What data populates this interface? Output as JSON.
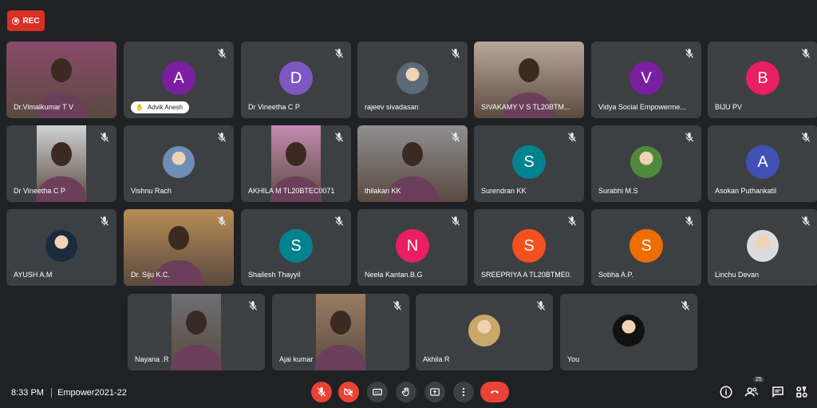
{
  "recording": {
    "label": "REC"
  },
  "participants": [
    {
      "name": "Dr.Vimalkumar T V",
      "type": "video",
      "color": "#8a4a6b"
    },
    {
      "name": "Advik Anesh",
      "type": "avatar",
      "initial": "A",
      "color": "#7b1fa2",
      "muted": true,
      "pill": true
    },
    {
      "name": "Dr Vineetha C P",
      "type": "avatar",
      "initial": "D",
      "color": "#7e57c2",
      "muted": true
    },
    {
      "name": "rajeev sivadasan",
      "type": "photo",
      "color": "#5b6a78",
      "muted": true
    },
    {
      "name": "SIVAKAMY V S TL20BTM...",
      "type": "video",
      "color": "#b9a89a"
    },
    {
      "name": "Vidya Social Empowerme...",
      "type": "avatar",
      "initial": "V",
      "color": "#7b1fa2",
      "muted": true
    },
    {
      "name": "BIJU PV",
      "type": "avatar",
      "initial": "B",
      "color": "#e91e63",
      "muted": true
    },
    {
      "name": "Dr Vineetha C P",
      "type": "video",
      "color": "#cfd2d4",
      "muted": true
    },
    {
      "name": "Vishnu Rach",
      "type": "photo",
      "color": "#6e8fb5",
      "muted": true
    },
    {
      "name": "AKHILA M TL20BTEC0071",
      "type": "video",
      "color": "#c58bb3",
      "muted": true
    },
    {
      "name": "thilakan KK",
      "type": "video",
      "color": "#8f8f8f",
      "muted": true
    },
    {
      "name": "Surendran KK",
      "type": "avatar",
      "initial": "S",
      "color": "#00838f",
      "muted": true
    },
    {
      "name": "Surabhi M.S",
      "type": "photo",
      "color": "#4f8a3a",
      "muted": true
    },
    {
      "name": "Asokan Puthankatil",
      "type": "avatar",
      "initial": "A",
      "color": "#3f51b5",
      "muted": true
    },
    {
      "name": "AYUSH A.M",
      "type": "photo",
      "color": "#1a2b3c",
      "muted": true
    },
    {
      "name": "Dr. Siju K.C.",
      "type": "video",
      "color": "#b88d55",
      "muted": true
    },
    {
      "name": "Shailesh Thayyil",
      "type": "avatar",
      "initial": "S",
      "color": "#00838f",
      "muted": true
    },
    {
      "name": "Neela Kantan.B.G",
      "type": "avatar",
      "initial": "N",
      "color": "#e91e63",
      "muted": true
    },
    {
      "name": "SREEPRIYA A TL20BTME0...",
      "type": "avatar",
      "initial": "S",
      "color": "#f4511e",
      "muted": true
    },
    {
      "name": "Sobha A.P.",
      "type": "avatar",
      "initial": "S",
      "color": "#ef6c00",
      "muted": true
    },
    {
      "name": "Linchu Devan",
      "type": "photo",
      "color": "#dcdcdc",
      "muted": true
    },
    {
      "name": "Nayana .R",
      "type": "video",
      "color": "#6d6f72",
      "muted": true
    },
    {
      "name": "Ajai kumar",
      "type": "video",
      "color": "#9a7d62",
      "muted": true
    },
    {
      "name": "Akhila R",
      "type": "photo",
      "color": "#c9a86a",
      "muted": true
    },
    {
      "name": "You",
      "type": "photo",
      "color": "#111111",
      "muted": true
    }
  ],
  "footer": {
    "time": "8:33 PM",
    "meeting": "Empower2021-22",
    "participant_count": "25",
    "controls": [
      "mic-off",
      "camera-off",
      "captions",
      "raise-hand",
      "present",
      "more",
      "leave"
    ]
  },
  "colors": {
    "background": "#202124",
    "tile": "#3c4043",
    "danger": "#ea4335"
  }
}
